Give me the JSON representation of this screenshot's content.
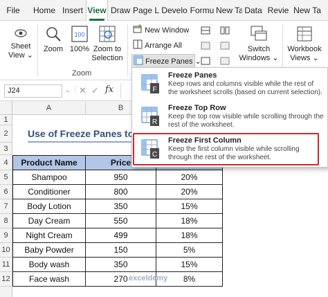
{
  "menu": {
    "tabs": [
      "File",
      "Home",
      "Insert",
      "View",
      "Draw",
      "Page L",
      "Develo",
      "Formu",
      "New Ta",
      "Data",
      "Revie",
      "New Ta"
    ],
    "active_tab": "View"
  },
  "ribbon": {
    "sheet_view_l1": "Sheet",
    "sheet_view_l2": "View ⌄",
    "zoom": "Zoom",
    "zoom100": "100%",
    "zoom_sel_l1": "Zoom to",
    "zoom_sel_l2": "Selection",
    "zoom_group": "Zoom",
    "new_window": "New Window",
    "arrange_all": "Arrange All",
    "freeze_panes": "Freeze Panes ⌄",
    "switch_l1": "Switch",
    "switch_l2": "Windows ⌄",
    "workbook_l1": "Workbook",
    "workbook_l2": "Views ⌄"
  },
  "formula_bar": {
    "name_box": "J24",
    "cancel": "✕",
    "enter": "✓",
    "fx": "fx"
  },
  "grid": {
    "columns": [
      "A",
      "B"
    ],
    "rows": [
      "1",
      "2",
      "3",
      "4",
      "5",
      "6",
      "7",
      "8",
      "9",
      "10",
      "11",
      "12"
    ],
    "title": "Use of Freeze Panes to",
    "headers": [
      "Product Name",
      "Price",
      ""
    ],
    "data": [
      [
        "Shampoo",
        "950",
        "20%"
      ],
      [
        "Conditioner",
        "800",
        "20%"
      ],
      [
        "Body Lotion",
        "350",
        "15%"
      ],
      [
        "Day Cream",
        "550",
        "18%"
      ],
      [
        "Night Cream",
        "499",
        "18%"
      ],
      [
        "Baby Powder",
        "150",
        "5%"
      ],
      [
        "Body wash",
        "350",
        "15%"
      ],
      [
        "Face wash",
        "270",
        "8%"
      ]
    ]
  },
  "dropdown": {
    "items": [
      {
        "title": "Freeze Panes",
        "desc": "Keep rows and columns visible while the rest of the worksheet scrolls (based on current selection)."
      },
      {
        "title": "Freeze Top Row",
        "desc": "Keep the top row visible while scrolling through the rest of the worksheet."
      },
      {
        "title": "Freeze First Column",
        "desc": "Keep the first column visible while scrolling through the rest of the worksheet."
      }
    ],
    "highlighted": "Freeze First Column"
  },
  "watermark": "exceldemy",
  "colors": {
    "accent_green": "#1e7145",
    "table_header_bg": "#b4c6e7",
    "title_color": "#2f4f7f",
    "highlight_red": "#d0262d",
    "icon_blue": "#2b7cd3"
  }
}
